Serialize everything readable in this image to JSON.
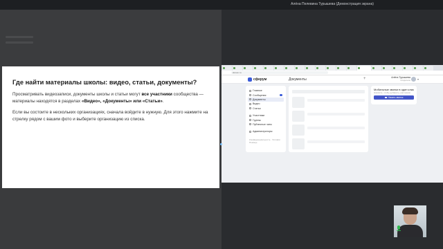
{
  "topbar": {
    "title": "Алёна Пелевина Турышева (Демонстрация экрана)"
  },
  "slide": {
    "heading": "Где найти материалы школы: видео, статьи, документы?",
    "p1_part1": "Просматривать видеозаписи, документы школы и статьи могут ",
    "p1_bold1": "все участники",
    "p1_part2": " сообщества — материалы находятся в разделах ",
    "p1_bold2": "«Видео», «Документы» или «Статьи»",
    "p1_end": ".",
    "p2": "Если вы состоите в нескольких организациях, сначала войдите в нужную. Для этого нажмите на стрелку рядом с вашим фото и выберите организацию из списка."
  },
  "browser": {
    "url": "sferum.ru",
    "app_name": "сферум",
    "page_title": "Документы",
    "user_name": "Алёна Турышева",
    "user_role": "Создатель"
  },
  "sidebar": {
    "items": [
      {
        "label": "Главное"
      },
      {
        "label": "Сообщения"
      },
      {
        "label": "Документы"
      },
      {
        "label": "Видео"
      },
      {
        "label": "Статьи"
      },
      {
        "label": "Участники"
      },
      {
        "label": "Группы"
      },
      {
        "label": "Публичные чаты"
      },
      {
        "label": "Администраторы"
      }
    ],
    "footer1": "Конфиденциальность · Условия",
    "footer2": "Помощь"
  },
  "widget": {
    "title": "Мобильные звонки в один клик",
    "subtitle": "Нажмите, чтобы добавить участников",
    "button": "Начать звонок"
  },
  "colors": {
    "accent": "#4255c8",
    "mic": "#2fb84f"
  }
}
